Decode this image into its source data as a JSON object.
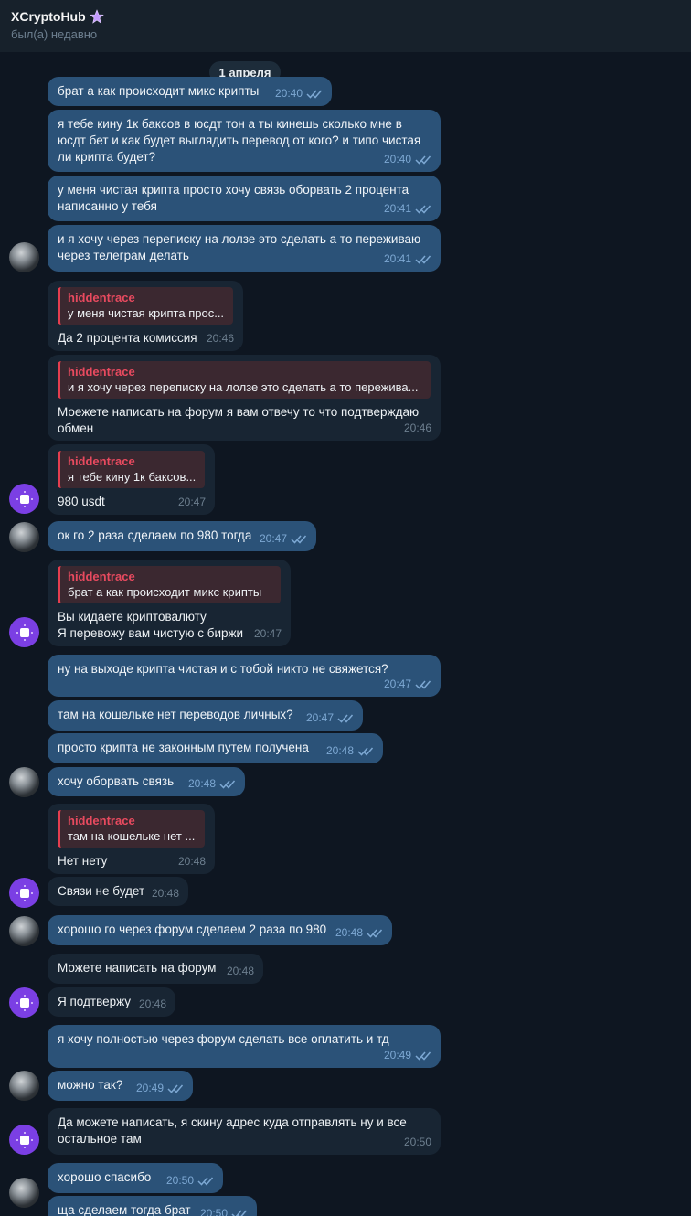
{
  "header": {
    "title": "XCryptoHub",
    "status": "был(а) недавно",
    "star_color": "#c39bff"
  },
  "chat": {
    "date": "1 апреля",
    "messages": [
      {
        "dir": "out",
        "text": "брат а как происходит микс крипты",
        "time": "20:40"
      },
      {
        "dir": "out",
        "text": "я тебе кину 1к баксов в юсдт тон а ты кинешь сколько мне в юсдт бет и как будет выглядить перевод от кого? и типо чистая ли крипта будет?",
        "time": "20:40"
      },
      {
        "dir": "out",
        "text": "у меня чистая крипта просто хочу связь оборвать 2 процента написанно у тебя",
        "time": "20:41"
      },
      {
        "dir": "out",
        "text": "и я хочу через переписку на лолзе это сделать а то переживаю через телеграм делать",
        "time": "20:41"
      },
      {
        "dir": "in",
        "reply_name": "hiddentrace",
        "reply_text": "у меня чистая крипта прос...",
        "text": "Да 2 процента комиссия",
        "time": "20:46"
      },
      {
        "dir": "in",
        "reply_name": "hiddentrace",
        "reply_text": "и я хочу через переписку на лолзе это сделать а то пережива...",
        "text": "Моежете написать на форум я вам отвечу то что подтверждаю обмен",
        "time": "20:46"
      },
      {
        "dir": "in",
        "reply_name": "hiddentrace",
        "reply_text": "я тебе кину 1к баксов...",
        "text": "980 usdt",
        "time": "20:47"
      },
      {
        "dir": "out",
        "text": "ок го 2 раза сделаем по 980 тогда",
        "time": "20:47"
      },
      {
        "dir": "in",
        "reply_name": "hiddentrace",
        "reply_text": "брат а как происходит микс крипты",
        "text": "Вы кидаете криптовалюту\nЯ перевожу вам чистую с биржи",
        "time": "20:47"
      },
      {
        "dir": "out",
        "text": "ну на выходе крипта чистая и с тобой никто не свяжется?",
        "time": "20:47"
      },
      {
        "dir": "out",
        "text": "там на кошельке нет переводов личных?",
        "time": "20:47"
      },
      {
        "dir": "out",
        "text": "просто крипта не законным путем получена",
        "time": "20:48"
      },
      {
        "dir": "out",
        "text": "хочу оборвать связь",
        "time": "20:48"
      },
      {
        "dir": "in",
        "reply_name": "hiddentrace",
        "reply_text": "там на кошельке нет ...",
        "text": "Нет нету",
        "time": "20:48"
      },
      {
        "dir": "in",
        "text": "Связи не будет",
        "time": "20:48"
      },
      {
        "dir": "out",
        "text": "хорошо го через форум сделаем 2 раза по 980",
        "time": "20:48"
      },
      {
        "dir": "in",
        "text": "Можете написать на форум",
        "time": "20:48"
      },
      {
        "dir": "in",
        "text": "Я подтвержу",
        "time": "20:48"
      },
      {
        "dir": "out",
        "text": "я хочу полностью через форум сделать все оплатить и тд",
        "time": "20:49"
      },
      {
        "dir": "out",
        "text": "можно так?",
        "time": "20:49"
      },
      {
        "dir": "in",
        "text": "Да можете написать, я скину адрес куда отправлять ну и все остальное там",
        "time": "20:50"
      },
      {
        "dir": "out",
        "text": "хорошо спасибо",
        "time": "20:50"
      },
      {
        "dir": "out",
        "text": "ща сделаем тогда брат",
        "time": "20:50"
      }
    ]
  },
  "avatars": {
    "user": "user-photo-avatar",
    "bot": "xcryptohub-bot-avatar",
    "bot_color": "#7b3fe4"
  }
}
